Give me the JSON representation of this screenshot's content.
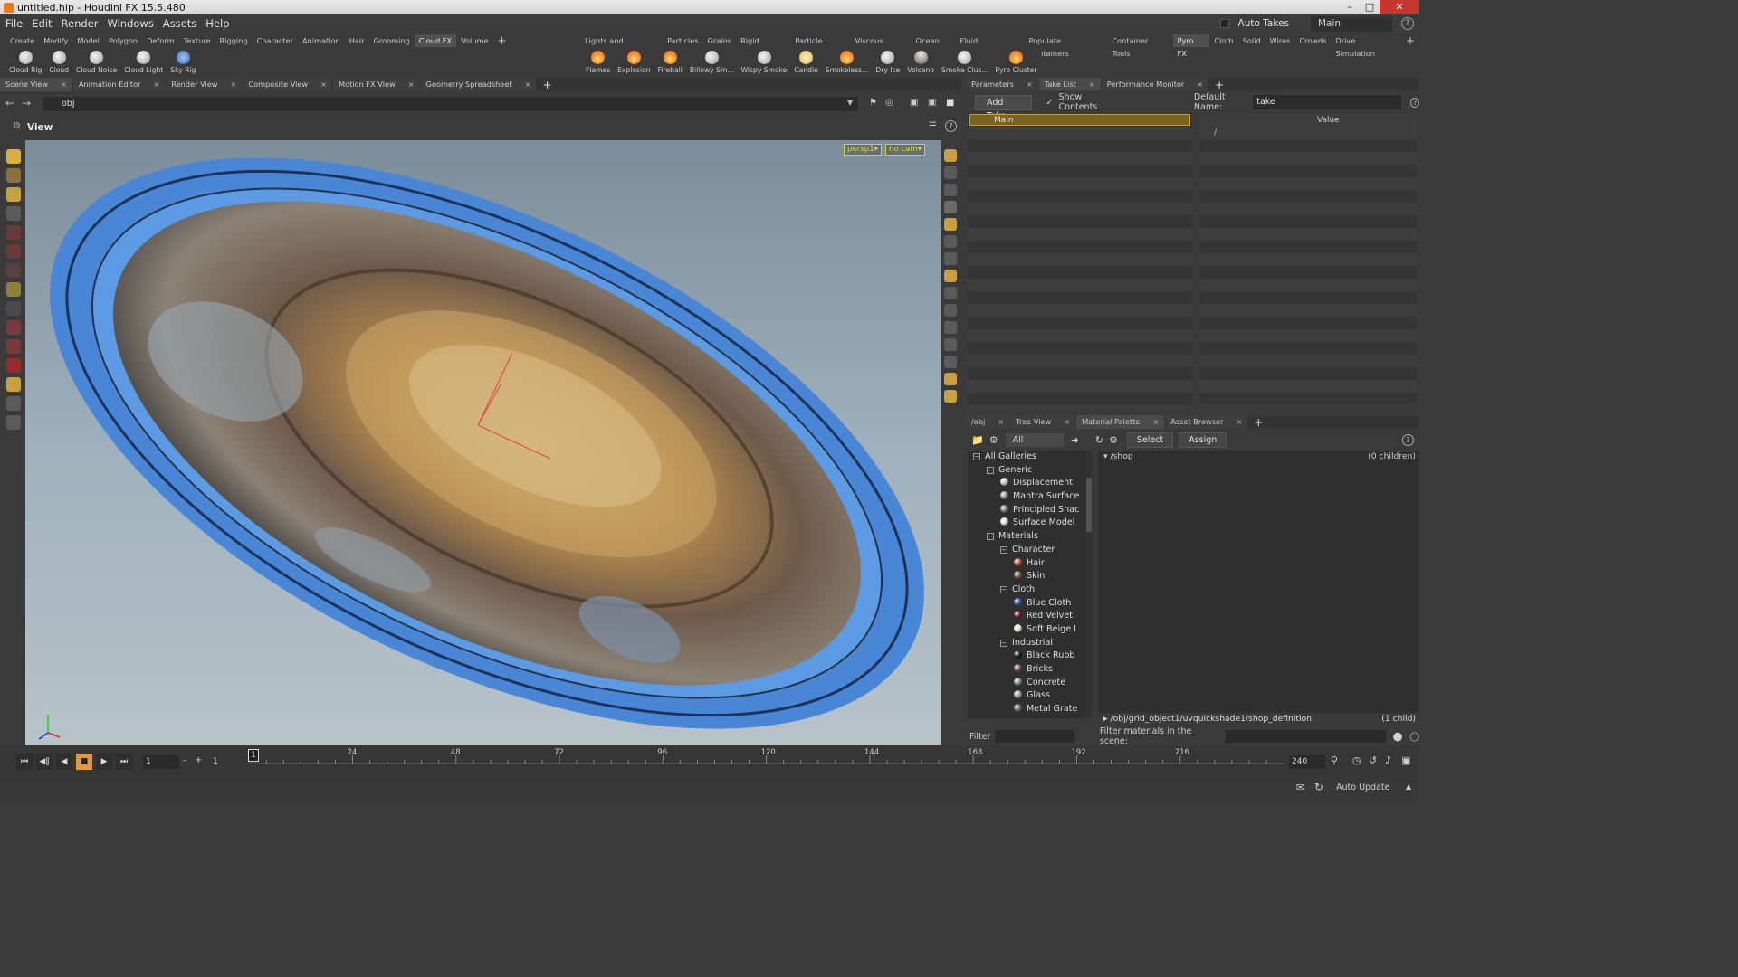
{
  "window": {
    "title": "untitled.hip - Houdini FX 15.5.480"
  },
  "menubar": {
    "items": [
      "File",
      "Edit",
      "Render",
      "Windows",
      "Assets",
      "Help"
    ],
    "auto_takes": "Auto Takes",
    "desktop": "Main"
  },
  "shelf_left": {
    "tabs": [
      "Create",
      "Modify",
      "Model",
      "Polygon",
      "Deform",
      "Texture",
      "Rigging",
      "Character",
      "Animation",
      "Hair",
      "Grooming",
      "Cloud FX",
      "Volume"
    ],
    "active_tab": "Cloud FX",
    "tools": [
      "Cloud Rig",
      "Cloud",
      "Cloud Noise",
      "Cloud Light",
      "Sky Rig"
    ]
  },
  "shelf_right": {
    "tabs": [
      "Lights and Cameras",
      "Particles",
      "Grains",
      "Rigid Bodies",
      "Particle Fluids",
      "Viscous Fluids",
      "Ocean FX",
      "Fluid Containers",
      "Populate Containers",
      "Container Tools",
      "Pyro FX",
      "Cloth",
      "Solid",
      "Wires",
      "Crowds",
      "Drive Simulation"
    ],
    "active_tab": "Pyro FX",
    "tools": [
      "Flames",
      "Explosion",
      "Fireball",
      "Billowy Sm...",
      "Wispy Smoke",
      "Candle",
      "Smokeless...",
      "Dry Ice",
      "Volcano",
      "Smoke Clus...",
      "Pyro Cluster"
    ]
  },
  "viewer_tabs": [
    "Scene View",
    "Animation Editor",
    "Render View",
    "Composite View",
    "Motion FX View",
    "Geometry Spreadsheet"
  ],
  "viewer": {
    "path": "obj",
    "label": "View",
    "camera": "persp1▾",
    "nocam": "no cam▾"
  },
  "param_tabs": [
    "Parameters",
    "Take List",
    "Performance Monitor"
  ],
  "takes": {
    "add_take": "Add Take",
    "show_contents": "Show Contents",
    "default_name_label": "Default Name:",
    "default_name": "take",
    "main_take": "Main",
    "value_header": "Value",
    "root_path": "/"
  },
  "gallery_tabs": [
    "/obj",
    "Tree View",
    "Material Palette",
    "Asset Browser"
  ],
  "gallery": {
    "filter_all": "All",
    "select": "Select",
    "assign": "Assign",
    "shop_path": "/shop",
    "shop_children": "(0 children)",
    "shop_def": "/obj/grid_object1/uvquickshade1/shop_definition",
    "shop_def_children": "(1 child)",
    "filter_label": "Filter",
    "filter_scene": "Filter materials in the scene:",
    "tree": [
      {
        "label": "All Galleries",
        "level": 0,
        "kind": "exp"
      },
      {
        "label": "Generic",
        "level": 1,
        "kind": "exp"
      },
      {
        "label": "Displacement",
        "level": 2,
        "kind": "ball",
        "color": "#bdbdbd"
      },
      {
        "label": "Mantra Surface",
        "level": 2,
        "kind": "ball",
        "color": "#8e8e8e"
      },
      {
        "label": "Principled Shac",
        "level": 2,
        "kind": "ball",
        "color": "#7d7d7d"
      },
      {
        "label": "Surface Model",
        "level": 2,
        "kind": "ball",
        "color": "#dcdcdc"
      },
      {
        "label": "Materials",
        "level": 1,
        "kind": "exp"
      },
      {
        "label": "Character",
        "level": 2,
        "kind": "exp"
      },
      {
        "label": "Hair",
        "level": 3,
        "kind": "ball",
        "color": "#c5563a"
      },
      {
        "label": "Skin",
        "level": 3,
        "kind": "ball",
        "color": "#8a5a48"
      },
      {
        "label": "Cloth",
        "level": 2,
        "kind": "exp"
      },
      {
        "label": "Blue Cloth",
        "level": 3,
        "kind": "ball",
        "color": "#3a5a9a"
      },
      {
        "label": "Red Velvet",
        "level": 3,
        "kind": "ball",
        "color": "#7a1a1a"
      },
      {
        "label": "Soft Beige I",
        "level": 3,
        "kind": "ball",
        "color": "#e6dcc6"
      },
      {
        "label": "Industrial",
        "level": 2,
        "kind": "exp"
      },
      {
        "label": "Black Rubb",
        "level": 3,
        "kind": "ball",
        "color": "#1c1c1c"
      },
      {
        "label": "Bricks",
        "level": 3,
        "kind": "ball",
        "color": "#7a5a4a"
      },
      {
        "label": "Concrete",
        "level": 3,
        "kind": "ball",
        "color": "#8a8a8a"
      },
      {
        "label": "Glass",
        "level": 3,
        "kind": "ball",
        "color": "#9aa2a8"
      },
      {
        "label": "Metal Grate",
        "level": 3,
        "kind": "ball",
        "color": "#6a6a6a"
      }
    ]
  },
  "timeline": {
    "frame": "1",
    "start": "1",
    "end": "240",
    "ticks": [
      "24",
      "48",
      "72",
      "96",
      "120",
      "144",
      "168",
      "192",
      "216"
    ],
    "current": "1"
  },
  "status": {
    "auto_update": "Auto Update"
  }
}
